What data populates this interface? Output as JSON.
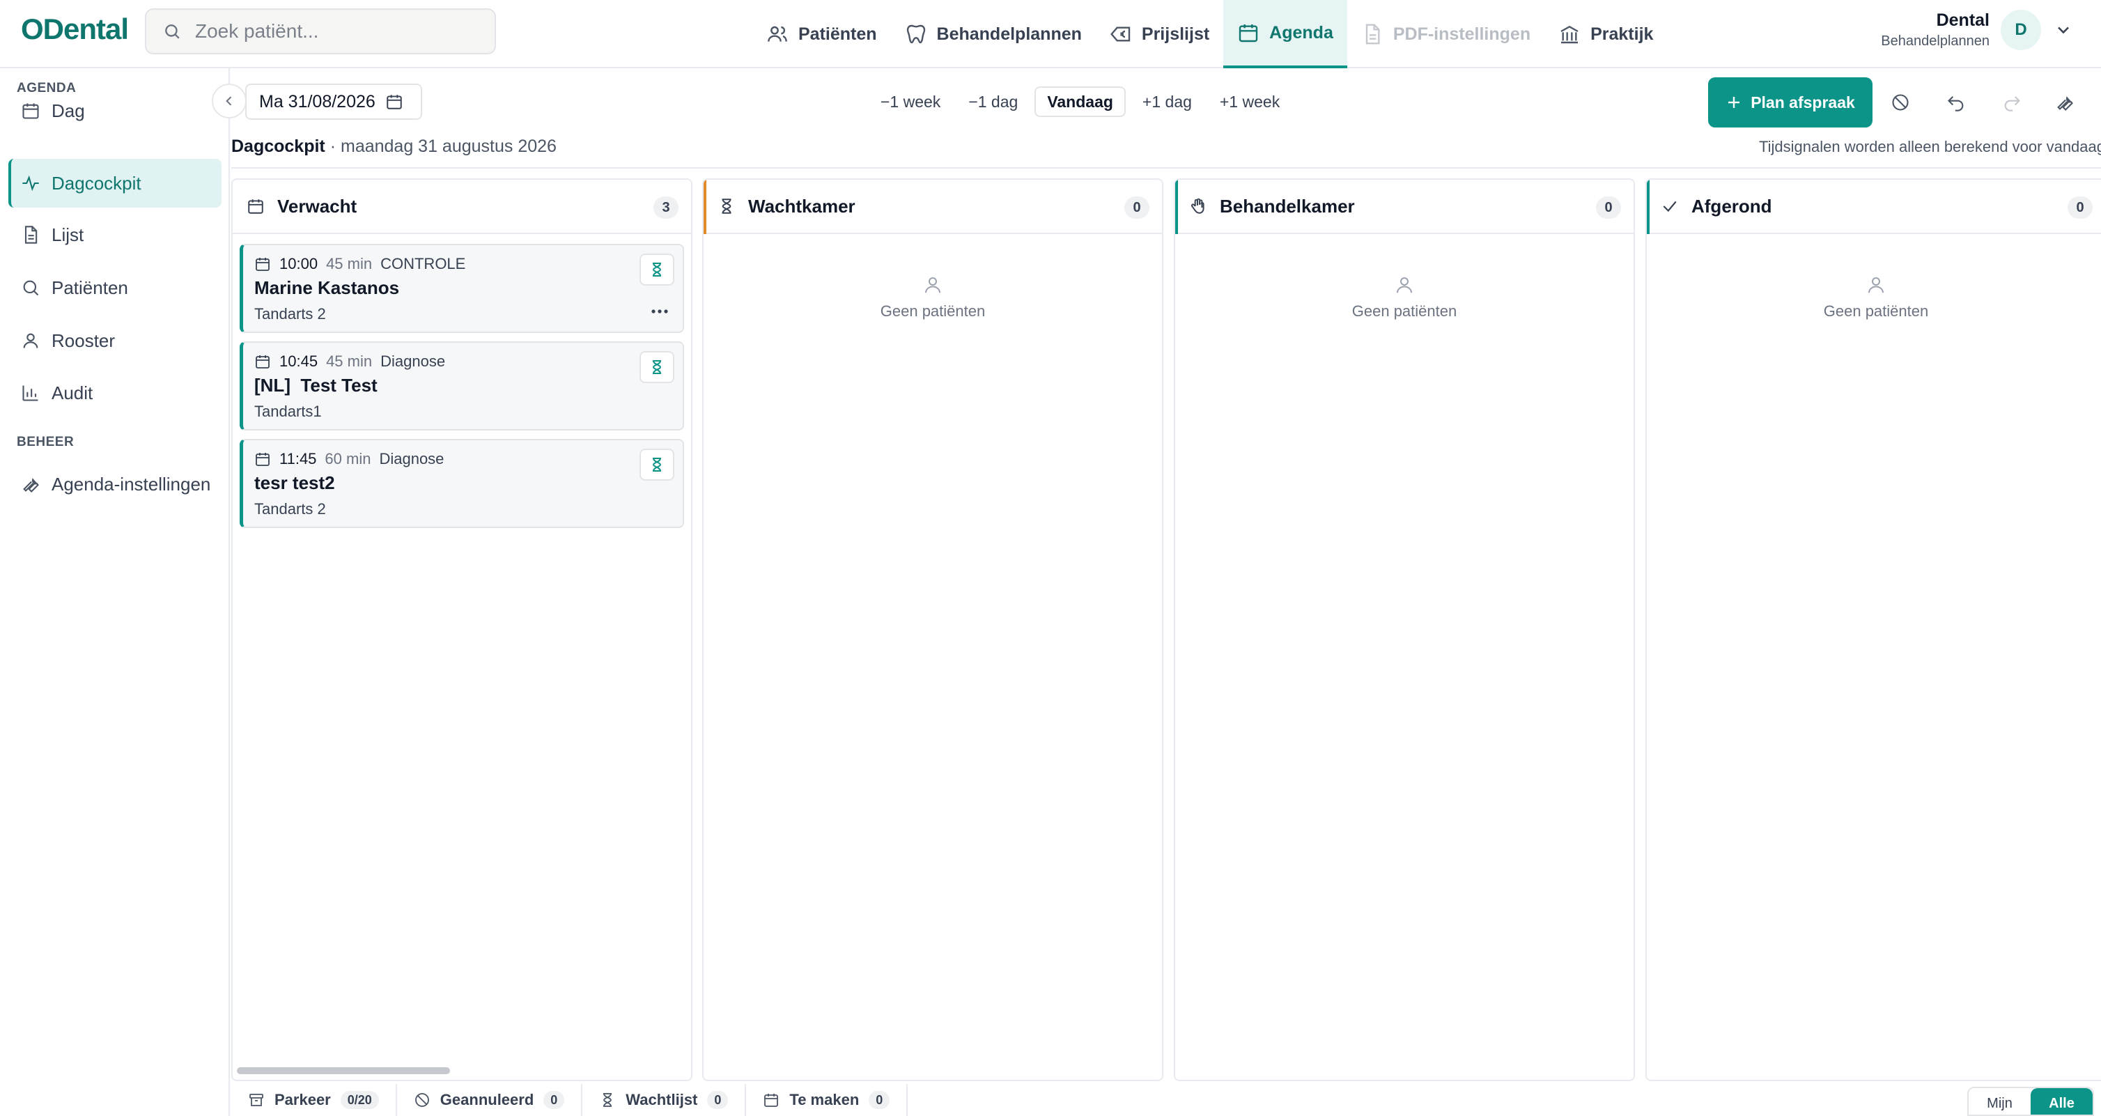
{
  "app": {
    "logo": "ODental"
  },
  "search": {
    "placeholder": "Zoek patiënt..."
  },
  "nav": {
    "items": [
      {
        "label": "Patiënten",
        "icon": "users-icon"
      },
      {
        "label": "Behandelplannen",
        "icon": "tooth-icon"
      },
      {
        "label": "Prijslijst",
        "icon": "euro-tag-icon"
      },
      {
        "label": "Agenda",
        "icon": "calendar-icon",
        "active": true
      },
      {
        "label": "PDF-instellingen",
        "icon": "document-icon",
        "disabled": true
      },
      {
        "label": "Praktijk",
        "icon": "building-icon"
      }
    ]
  },
  "user": {
    "name": "Dental",
    "subtitle": "Behandelplannen",
    "initial": "D"
  },
  "sidebar": {
    "section_agenda": "AGENDA",
    "section_beheer": "BEHEER",
    "items": [
      {
        "label": "Dag",
        "icon": "calendar-icon"
      },
      {
        "label": "Dagcockpit",
        "icon": "activity-icon",
        "active": true
      },
      {
        "label": "Lijst",
        "icon": "document-icon"
      },
      {
        "label": "Patiënten",
        "icon": "search-icon"
      },
      {
        "label": "Rooster",
        "icon": "user-icon"
      },
      {
        "label": "Audit",
        "icon": "bar-chart-icon"
      }
    ],
    "beheer_items": [
      {
        "label": "Agenda-instellingen",
        "icon": "wrench-icon"
      }
    ]
  },
  "toolbar": {
    "date": "Ma 31/08/2026",
    "steps": [
      "−1 week",
      "−1 dag",
      "Vandaag",
      "+1 dag",
      "+1 week"
    ],
    "plan_label": "Plan afspraak"
  },
  "info": {
    "title": "Dagcockpit",
    "date": "· maandag 31 augustus 2026",
    "note": "Tijdsignalen worden alleen berekend voor vandaag"
  },
  "columns": [
    {
      "title": "Verwacht",
      "count": "3",
      "icon": "calendar-icon",
      "cards": [
        {
          "time": "10:00",
          "duration": "45 min",
          "type": "CONTROLE",
          "name": "Marine Kastanos",
          "dentist": "Tandarts 2"
        },
        {
          "time": "10:45",
          "duration": "45 min",
          "type": "Diagnose",
          "name": "[NL]  Test Test",
          "dentist": "Tandarts1"
        },
        {
          "time": "11:45",
          "duration": "60 min",
          "type": "Diagnose",
          "name": "tesr test2",
          "dentist": "Tandarts 2"
        }
      ]
    },
    {
      "title": "Wachtkamer",
      "count": "0",
      "icon": "hourglass-icon",
      "accent": "#e08a2c",
      "empty": "Geen patiënten"
    },
    {
      "title": "Behandelkamer",
      "count": "0",
      "icon": "hand-icon",
      "accent": "#0d9488",
      "empty": "Geen patiënten"
    },
    {
      "title": "Afgerond",
      "count": "0",
      "icon": "check-icon",
      "accent": "#0d9488",
      "empty": "Geen patiënten"
    }
  ],
  "bottombar": {
    "items": [
      {
        "label": "Parkeer",
        "count": "0/20",
        "icon": "archive-icon"
      },
      {
        "label": "Geannuleerd",
        "count": "0",
        "icon": "ban-icon"
      },
      {
        "label": "Wachtlijst",
        "count": "0",
        "icon": "hourglass-icon"
      },
      {
        "label": "Te maken",
        "count": "0",
        "icon": "calendar-icon"
      }
    ],
    "toggle": [
      "Mijn",
      "Alle"
    ]
  },
  "colors": {
    "accent": "#0d9488",
    "brand": "#0f766e",
    "waiting": "#e08a2c"
  }
}
